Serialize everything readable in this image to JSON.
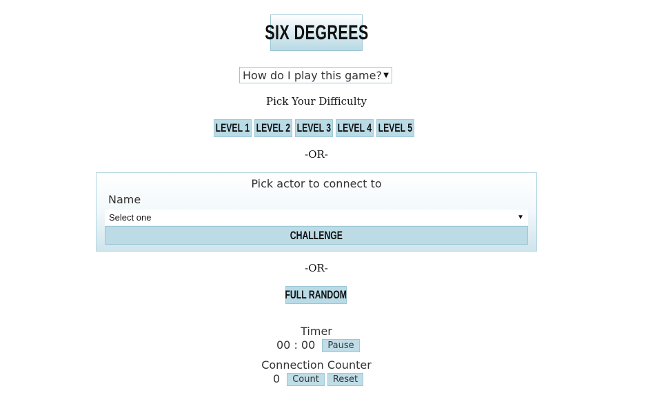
{
  "title": "SIX DEGREES",
  "how_to": {
    "selected": "How do I play this game?"
  },
  "difficulty": {
    "label": "Pick Your Difficulty",
    "levels": [
      "LEVEL 1",
      "LEVEL 2",
      "LEVEL 3",
      "LEVEL 4",
      "LEVEL 5"
    ]
  },
  "separator": "-OR-",
  "actor_panel": {
    "heading": "Pick actor to connect to",
    "name_label": "Name",
    "select_value": "Select one",
    "challenge_label": "CHALLENGE"
  },
  "full_random_label": "FULL RANDOM",
  "timer": {
    "label": "Timer",
    "value": "00 : 00",
    "pause_label": "Pause"
  },
  "counter": {
    "label": "Connection Counter",
    "value": "0",
    "count_label": "Count",
    "reset_label": "Reset"
  },
  "colors": {
    "button_fill": "#b9dbe6",
    "button_border": "#9cc7d6"
  }
}
